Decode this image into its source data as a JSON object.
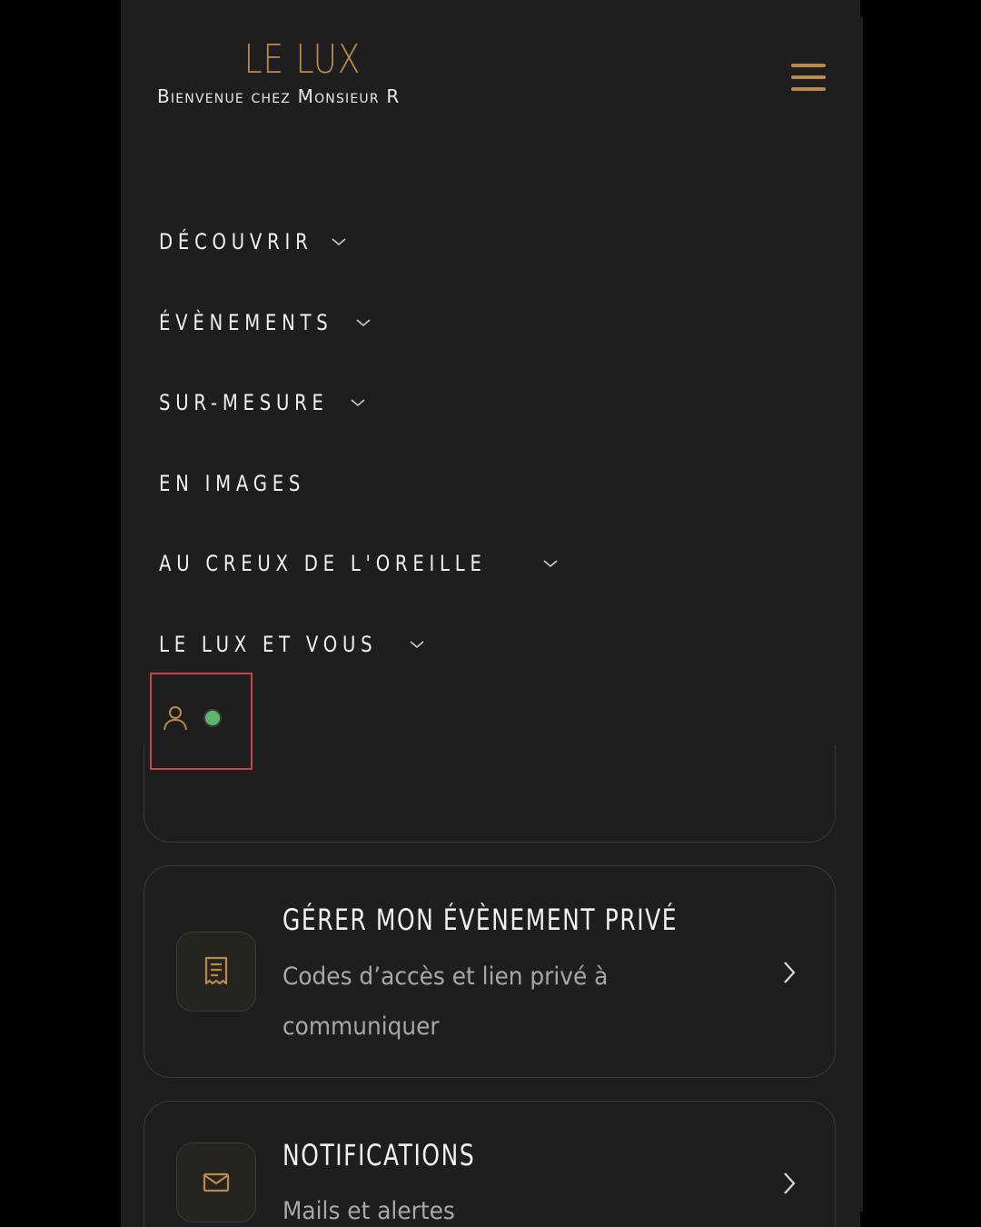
{
  "brand": {
    "title": "LE LUX",
    "subtitle": "Bienvenue chez Monsieur R"
  },
  "header": {
    "menu_icon": "hamburger-icon"
  },
  "nav": {
    "items": [
      {
        "label": "DÉCOUVRIR",
        "has_submenu": true
      },
      {
        "label": "ÉVÈNEMENTS",
        "has_submenu": true
      },
      {
        "label": "SUR-MESURE",
        "has_submenu": true
      },
      {
        "label": "EN IMAGES",
        "has_submenu": false
      },
      {
        "label": "AU CREUX DE L'OREILLE",
        "has_submenu": true
      },
      {
        "label": "LE LUX ET VOUS",
        "has_submenu": true
      }
    ]
  },
  "account": {
    "icon": "user-icon",
    "status": "online",
    "status_color": "#5cb76a"
  },
  "cards": [
    {
      "title": "GÉRER MON ÉVÈNEMENT PRIVÉ",
      "description": "Codes d’accès et lien privé à communiquer",
      "icon": "receipt-icon"
    },
    {
      "title": "NOTIFICATIONS",
      "description": "Mails et alertes",
      "icon": "mail-icon"
    }
  ],
  "colors": {
    "accent": "#b98a4c",
    "background": "#1e1e1e",
    "highlight_border": "#c9434b"
  }
}
